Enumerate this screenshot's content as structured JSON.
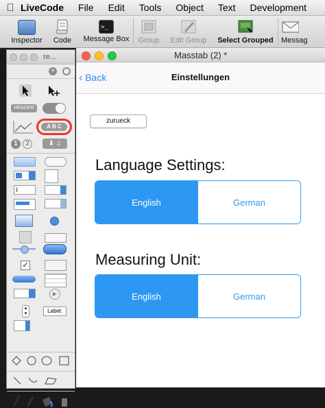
{
  "menubar": {
    "apple": "",
    "items": [
      "LiveCode",
      "File",
      "Edit",
      "Tools",
      "Object",
      "Text",
      "Development"
    ]
  },
  "toolbar": {
    "items": [
      {
        "label": "Inspector",
        "icon": "inspector-icon",
        "enabled": true
      },
      {
        "label": "Code",
        "icon": "code-scroll-icon",
        "enabled": true
      },
      {
        "label": "Message Box",
        "icon": "terminal-icon",
        "enabled": true
      },
      {
        "label": "Group",
        "icon": "group-icon",
        "enabled": false
      },
      {
        "label": "Edit Group",
        "icon": "edit-group-icon",
        "enabled": false
      },
      {
        "label": "Select Grouped",
        "icon": "select-grouped-icon",
        "enabled": true
      },
      {
        "label": "Messag",
        "icon": "envelope-icon",
        "enabled": true
      }
    ]
  },
  "palette": {
    "title": "re...",
    "header_label": "HEADER",
    "abc_label": "A B C",
    "label_tool": "Label:"
  },
  "window": {
    "title": "Masstab (2) *",
    "nav": {
      "back": "Back",
      "title": "Einstellungen"
    },
    "zurueck_button": "zurueck",
    "language": {
      "heading": "Language Settings:",
      "options": [
        "English",
        "German"
      ],
      "selected": "English"
    },
    "measuring": {
      "heading": "Measuring Unit:",
      "options": [
        "English",
        "German"
      ],
      "selected": "English"
    }
  },
  "colors": {
    "accent": "#2e97f1",
    "highlight_circle": "#e8362d",
    "close": "#fc5f57",
    "minimize": "#fdbc2e",
    "zoom": "#28c840"
  }
}
